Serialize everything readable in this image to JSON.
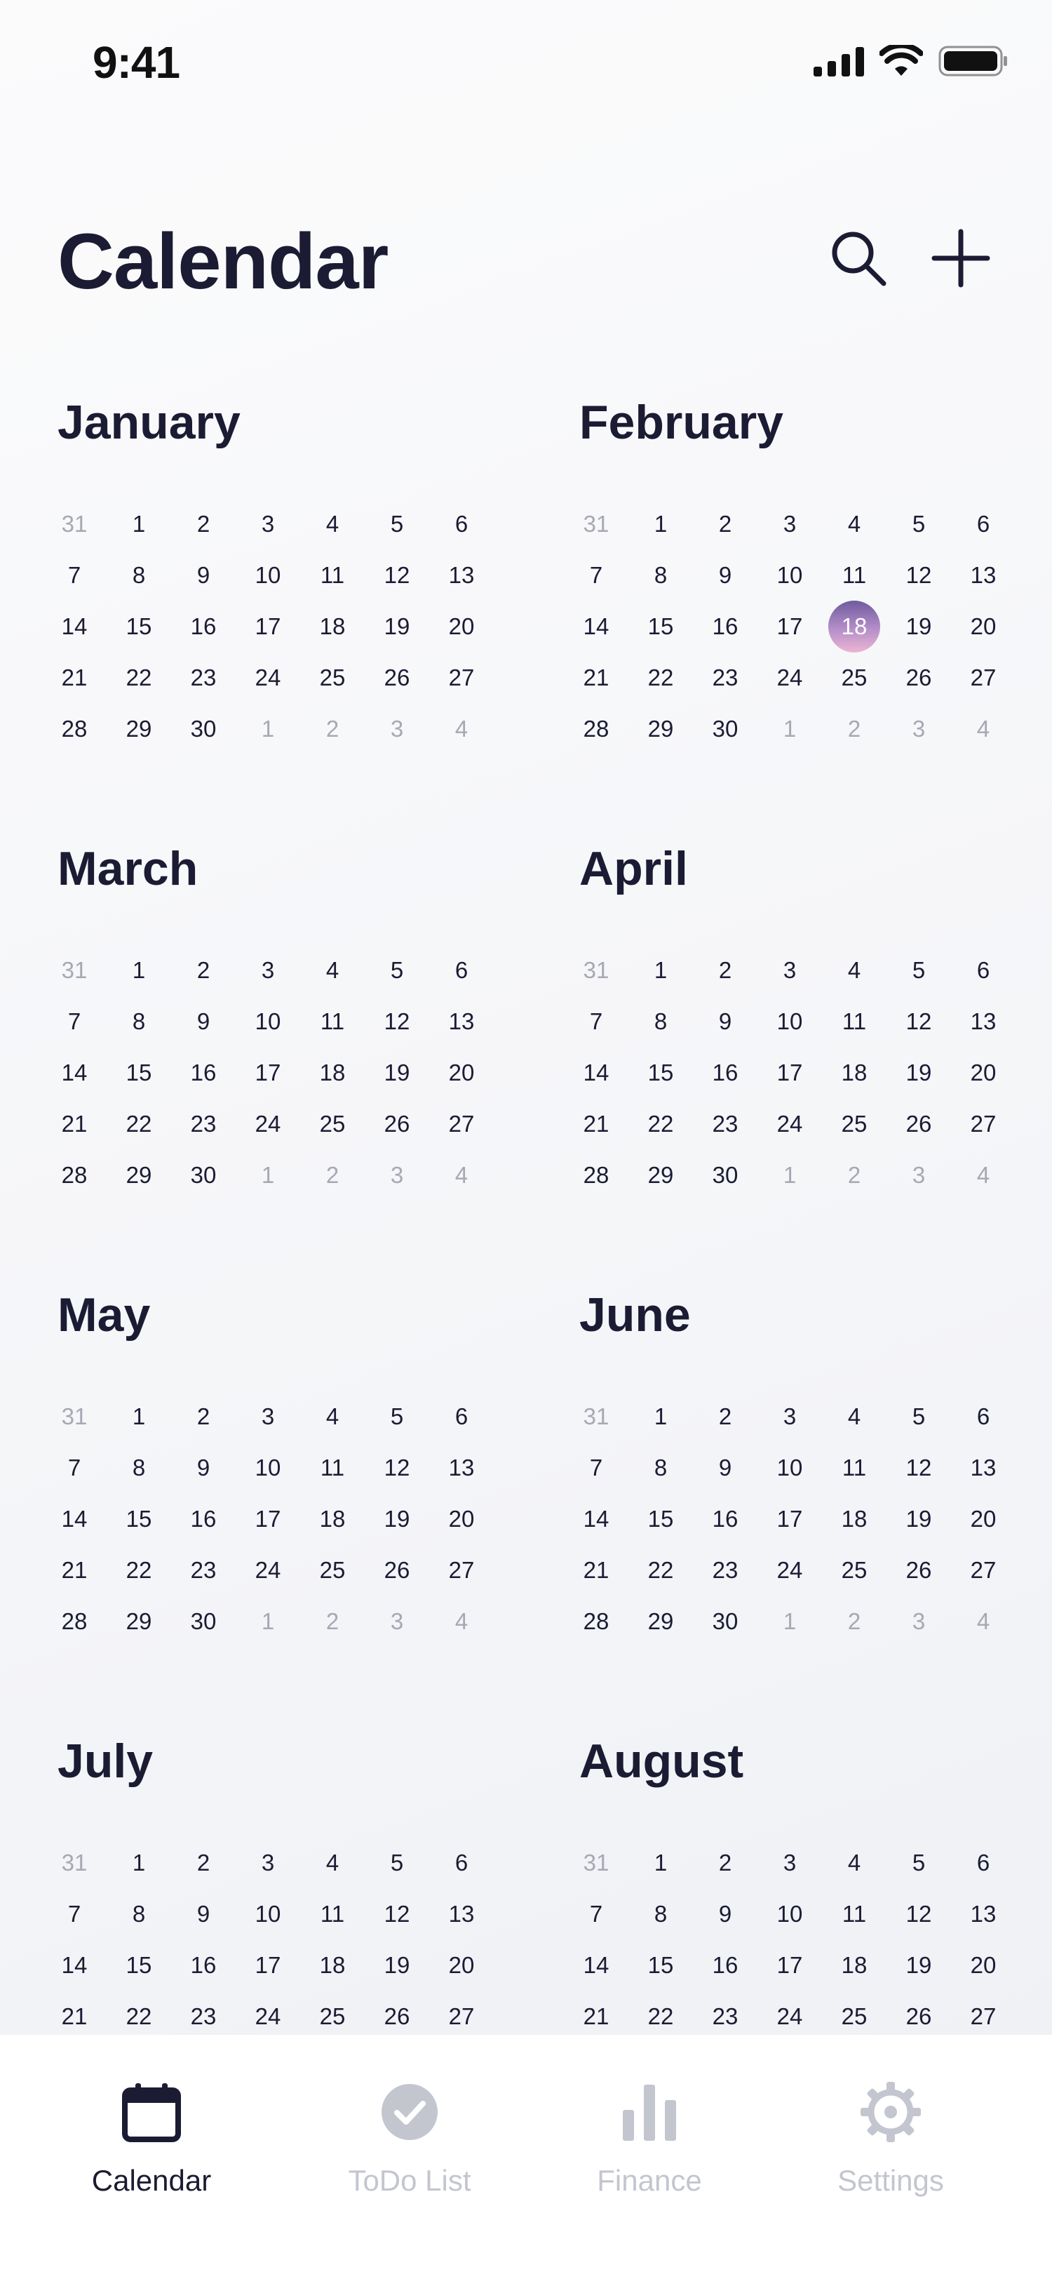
{
  "status_bar": {
    "time": "9:41"
  },
  "header": {
    "title": "Calendar"
  },
  "months": [
    {
      "name": "January"
    },
    {
      "name": "February"
    },
    {
      "name": "March"
    },
    {
      "name": "April"
    },
    {
      "name": "May"
    },
    {
      "name": "June"
    },
    {
      "name": "July"
    },
    {
      "name": "August"
    }
  ],
  "day_rows": [
    [
      {
        "d": "31",
        "muted": true
      },
      {
        "d": "1"
      },
      {
        "d": "2"
      },
      {
        "d": "3"
      },
      {
        "d": "4"
      },
      {
        "d": "5"
      },
      {
        "d": "6"
      }
    ],
    [
      {
        "d": "7"
      },
      {
        "d": "8"
      },
      {
        "d": "9"
      },
      {
        "d": "10"
      },
      {
        "d": "11"
      },
      {
        "d": "12"
      },
      {
        "d": "13"
      }
    ],
    [
      {
        "d": "14"
      },
      {
        "d": "15"
      },
      {
        "d": "16"
      },
      {
        "d": "17"
      },
      {
        "d": "18"
      },
      {
        "d": "19"
      },
      {
        "d": "20"
      }
    ],
    [
      {
        "d": "21"
      },
      {
        "d": "22"
      },
      {
        "d": "23"
      },
      {
        "d": "24"
      },
      {
        "d": "25"
      },
      {
        "d": "26"
      },
      {
        "d": "27"
      }
    ],
    [
      {
        "d": "28"
      },
      {
        "d": "29"
      },
      {
        "d": "30"
      },
      {
        "d": "1",
        "muted": true
      },
      {
        "d": "2",
        "muted": true
      },
      {
        "d": "3",
        "muted": true
      },
      {
        "d": "4",
        "muted": true
      }
    ]
  ],
  "visible_rows": [
    5,
    5,
    5,
    5,
    5,
    5,
    4,
    4
  ],
  "highlight": {
    "month_index": 1,
    "day": "18"
  },
  "tab_bar": {
    "tabs": [
      {
        "label": "Calendar",
        "icon": "calendar-icon",
        "active": true
      },
      {
        "label": "ToDo List",
        "icon": "check-circle-icon",
        "active": false
      },
      {
        "label": "Finance",
        "icon": "bar-chart-icon",
        "active": false
      },
      {
        "label": "Settings",
        "icon": "gear-icon",
        "active": false
      }
    ]
  },
  "colors": {
    "text": "#1b1c33",
    "muted": "#a6a8b3",
    "inactive_tab": "#c3c6cf",
    "highlight_gradient_top": "#6f5a9e",
    "highlight_gradient_bottom": "#ecb5d3"
  }
}
